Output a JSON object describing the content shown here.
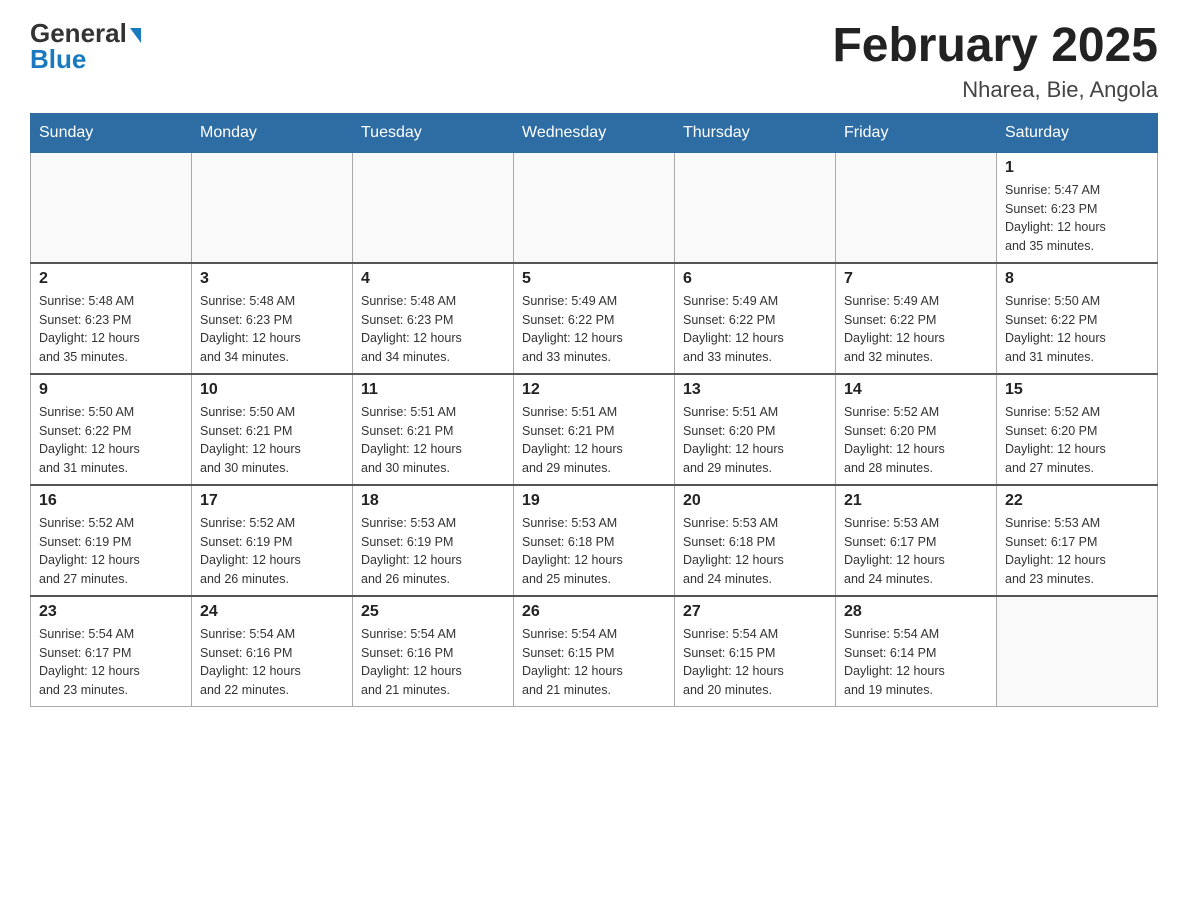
{
  "header": {
    "logo": {
      "general": "General",
      "blue": "Blue",
      "arrow": "▶"
    },
    "title": "February 2025",
    "location": "Nharea, Bie, Angola"
  },
  "calendar": {
    "days_of_week": [
      "Sunday",
      "Monday",
      "Tuesday",
      "Wednesday",
      "Thursday",
      "Friday",
      "Saturday"
    ],
    "weeks": [
      [
        {
          "day": "",
          "info": ""
        },
        {
          "day": "",
          "info": ""
        },
        {
          "day": "",
          "info": ""
        },
        {
          "day": "",
          "info": ""
        },
        {
          "day": "",
          "info": ""
        },
        {
          "day": "",
          "info": ""
        },
        {
          "day": "1",
          "info": "Sunrise: 5:47 AM\nSunset: 6:23 PM\nDaylight: 12 hours\nand 35 minutes."
        }
      ],
      [
        {
          "day": "2",
          "info": "Sunrise: 5:48 AM\nSunset: 6:23 PM\nDaylight: 12 hours\nand 35 minutes."
        },
        {
          "day": "3",
          "info": "Sunrise: 5:48 AM\nSunset: 6:23 PM\nDaylight: 12 hours\nand 34 minutes."
        },
        {
          "day": "4",
          "info": "Sunrise: 5:48 AM\nSunset: 6:23 PM\nDaylight: 12 hours\nand 34 minutes."
        },
        {
          "day": "5",
          "info": "Sunrise: 5:49 AM\nSunset: 6:22 PM\nDaylight: 12 hours\nand 33 minutes."
        },
        {
          "day": "6",
          "info": "Sunrise: 5:49 AM\nSunset: 6:22 PM\nDaylight: 12 hours\nand 33 minutes."
        },
        {
          "day": "7",
          "info": "Sunrise: 5:49 AM\nSunset: 6:22 PM\nDaylight: 12 hours\nand 32 minutes."
        },
        {
          "day": "8",
          "info": "Sunrise: 5:50 AM\nSunset: 6:22 PM\nDaylight: 12 hours\nand 31 minutes."
        }
      ],
      [
        {
          "day": "9",
          "info": "Sunrise: 5:50 AM\nSunset: 6:22 PM\nDaylight: 12 hours\nand 31 minutes."
        },
        {
          "day": "10",
          "info": "Sunrise: 5:50 AM\nSunset: 6:21 PM\nDaylight: 12 hours\nand 30 minutes."
        },
        {
          "day": "11",
          "info": "Sunrise: 5:51 AM\nSunset: 6:21 PM\nDaylight: 12 hours\nand 30 minutes."
        },
        {
          "day": "12",
          "info": "Sunrise: 5:51 AM\nSunset: 6:21 PM\nDaylight: 12 hours\nand 29 minutes."
        },
        {
          "day": "13",
          "info": "Sunrise: 5:51 AM\nSunset: 6:20 PM\nDaylight: 12 hours\nand 29 minutes."
        },
        {
          "day": "14",
          "info": "Sunrise: 5:52 AM\nSunset: 6:20 PM\nDaylight: 12 hours\nand 28 minutes."
        },
        {
          "day": "15",
          "info": "Sunrise: 5:52 AM\nSunset: 6:20 PM\nDaylight: 12 hours\nand 27 minutes."
        }
      ],
      [
        {
          "day": "16",
          "info": "Sunrise: 5:52 AM\nSunset: 6:19 PM\nDaylight: 12 hours\nand 27 minutes."
        },
        {
          "day": "17",
          "info": "Sunrise: 5:52 AM\nSunset: 6:19 PM\nDaylight: 12 hours\nand 26 minutes."
        },
        {
          "day": "18",
          "info": "Sunrise: 5:53 AM\nSunset: 6:19 PM\nDaylight: 12 hours\nand 26 minutes."
        },
        {
          "day": "19",
          "info": "Sunrise: 5:53 AM\nSunset: 6:18 PM\nDaylight: 12 hours\nand 25 minutes."
        },
        {
          "day": "20",
          "info": "Sunrise: 5:53 AM\nSunset: 6:18 PM\nDaylight: 12 hours\nand 24 minutes."
        },
        {
          "day": "21",
          "info": "Sunrise: 5:53 AM\nSunset: 6:17 PM\nDaylight: 12 hours\nand 24 minutes."
        },
        {
          "day": "22",
          "info": "Sunrise: 5:53 AM\nSunset: 6:17 PM\nDaylight: 12 hours\nand 23 minutes."
        }
      ],
      [
        {
          "day": "23",
          "info": "Sunrise: 5:54 AM\nSunset: 6:17 PM\nDaylight: 12 hours\nand 23 minutes."
        },
        {
          "day": "24",
          "info": "Sunrise: 5:54 AM\nSunset: 6:16 PM\nDaylight: 12 hours\nand 22 minutes."
        },
        {
          "day": "25",
          "info": "Sunrise: 5:54 AM\nSunset: 6:16 PM\nDaylight: 12 hours\nand 21 minutes."
        },
        {
          "day": "26",
          "info": "Sunrise: 5:54 AM\nSunset: 6:15 PM\nDaylight: 12 hours\nand 21 minutes."
        },
        {
          "day": "27",
          "info": "Sunrise: 5:54 AM\nSunset: 6:15 PM\nDaylight: 12 hours\nand 20 minutes."
        },
        {
          "day": "28",
          "info": "Sunrise: 5:54 AM\nSunset: 6:14 PM\nDaylight: 12 hours\nand 19 minutes."
        },
        {
          "day": "",
          "info": ""
        }
      ]
    ]
  }
}
